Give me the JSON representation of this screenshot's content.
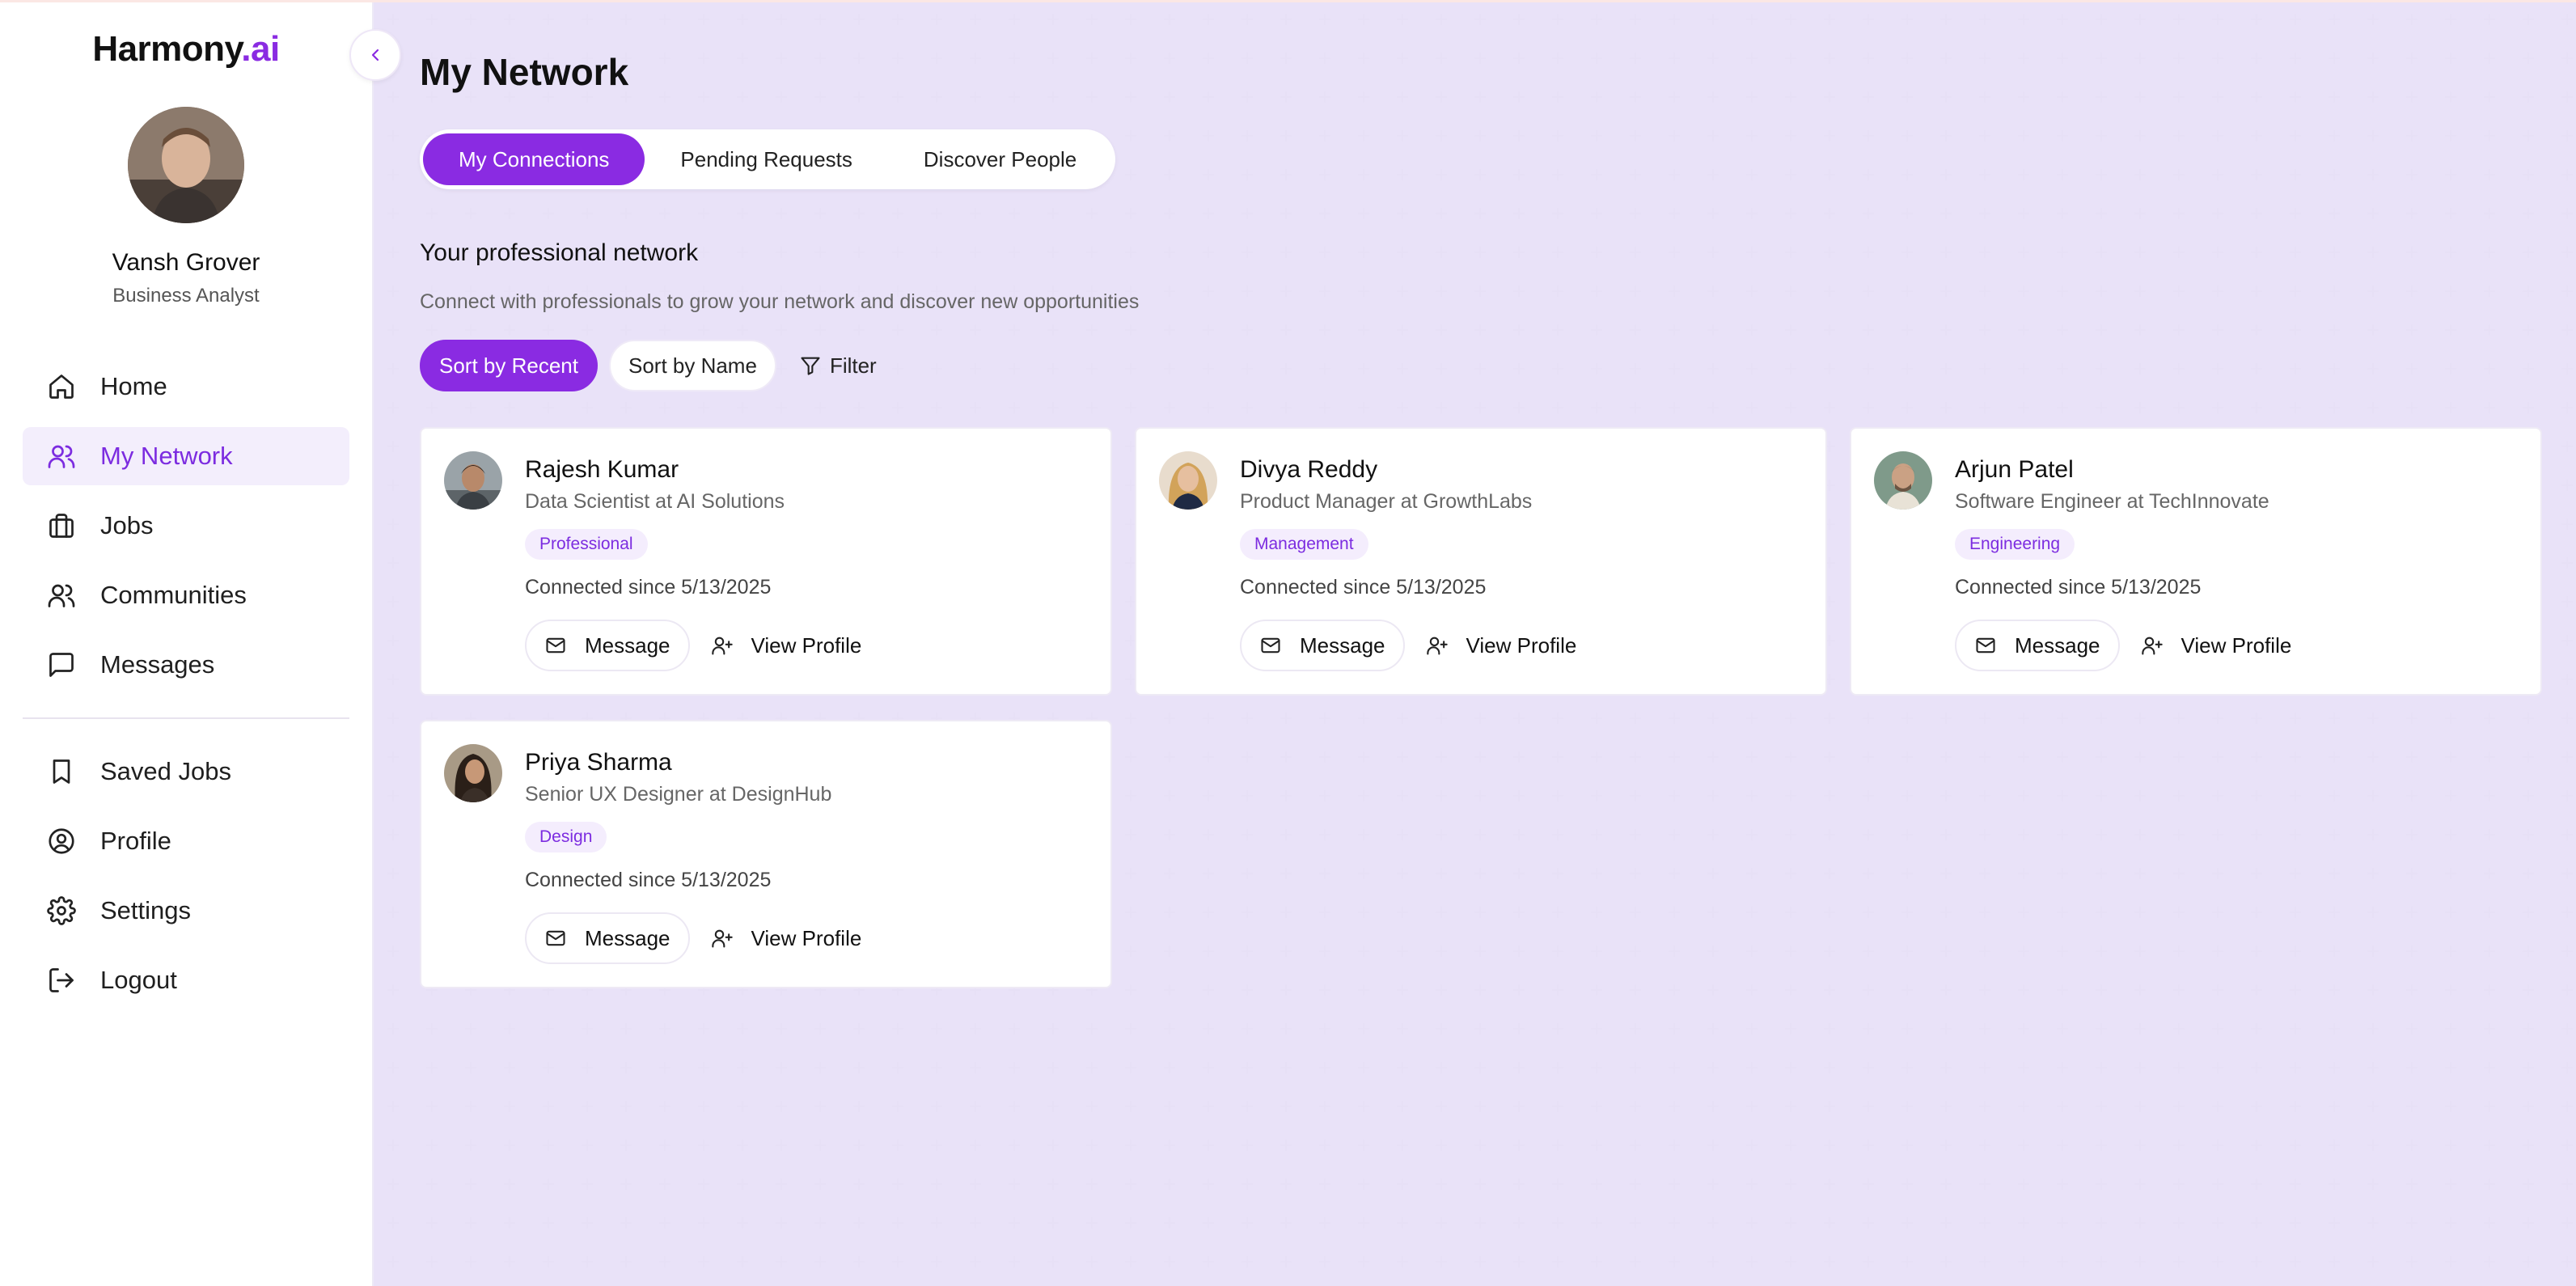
{
  "brand": {
    "name": "Harmony",
    "accent": ".ai"
  },
  "user": {
    "name": "Vansh Grover",
    "role": "Business Analyst"
  },
  "nav": {
    "primary": [
      {
        "label": "Home",
        "icon": "home-icon"
      },
      {
        "label": "My Network",
        "icon": "users-icon",
        "active": true
      },
      {
        "label": "Jobs",
        "icon": "briefcase-icon"
      },
      {
        "label": "Communities",
        "icon": "users-icon"
      },
      {
        "label": "Messages",
        "icon": "message-square-icon"
      }
    ],
    "secondary": [
      {
        "label": "Saved Jobs",
        "icon": "bookmark-icon"
      },
      {
        "label": "Profile",
        "icon": "user-circle-icon"
      },
      {
        "label": "Settings",
        "icon": "gear-icon"
      },
      {
        "label": "Logout",
        "icon": "logout-icon"
      }
    ]
  },
  "page": {
    "title": "My Network",
    "tabs": [
      "My Connections",
      "Pending Requests",
      "Discover People"
    ],
    "section_title": "Your professional network",
    "section_subtitle": "Connect with professionals to grow your network and discover new opportunities",
    "sort": {
      "recent": "Sort by Recent",
      "name": "Sort by Name",
      "filter": "Filter"
    }
  },
  "connections": [
    {
      "name": "Rajesh Kumar",
      "title": "Data Scientist at AI Solutions",
      "tag": "Professional",
      "since": "Connected since 5/13/2025",
      "message": "Message",
      "view": "View Profile"
    },
    {
      "name": "Divya Reddy",
      "title": "Product Manager at GrowthLabs",
      "tag": "Management",
      "since": "Connected since 5/13/2025",
      "message": "Message",
      "view": "View Profile"
    },
    {
      "name": "Arjun Patel",
      "title": "Software Engineer at TechInnovate",
      "tag": "Engineering",
      "since": "Connected since 5/13/2025",
      "message": "Message",
      "view": "View Profile"
    },
    {
      "name": "Priya Sharma",
      "title": "Senior UX Designer at DesignHub",
      "tag": "Design",
      "since": "Connected since 5/13/2025",
      "message": "Message",
      "view": "View Profile"
    }
  ],
  "colors": {
    "accent": "#8a2be2",
    "tag_bg": "#f4edfd",
    "page_bg": "#f6f3fd"
  }
}
